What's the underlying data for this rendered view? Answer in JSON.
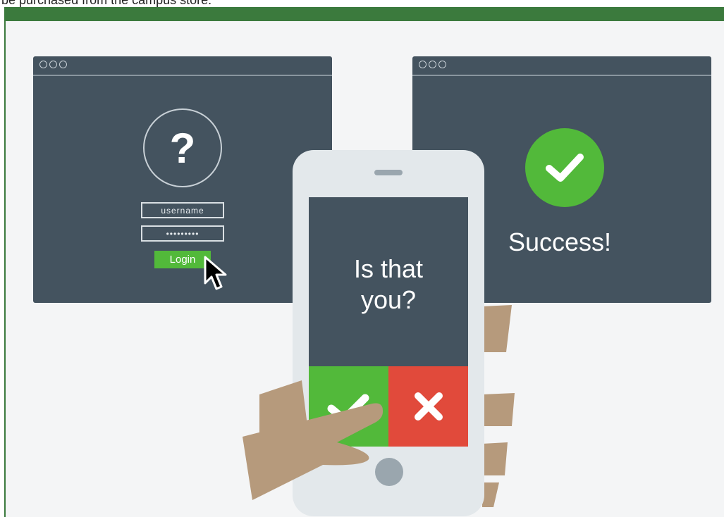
{
  "caption": {
    "text": "be purchased from the campus store."
  },
  "login_window": {
    "question_mark": "?",
    "username_placeholder": "username",
    "password_value": "•••••••••",
    "login_label": "Login"
  },
  "phone": {
    "prompt_line1": "Is that",
    "prompt_line2": "you?"
  },
  "success_window": {
    "message": "Success!"
  },
  "colors": {
    "window_bg": "#44535f",
    "accent_green": "#52b93a",
    "reject_red": "#e14a3b",
    "header_green": "#3b7a3d",
    "hand": "#b69a7c"
  }
}
